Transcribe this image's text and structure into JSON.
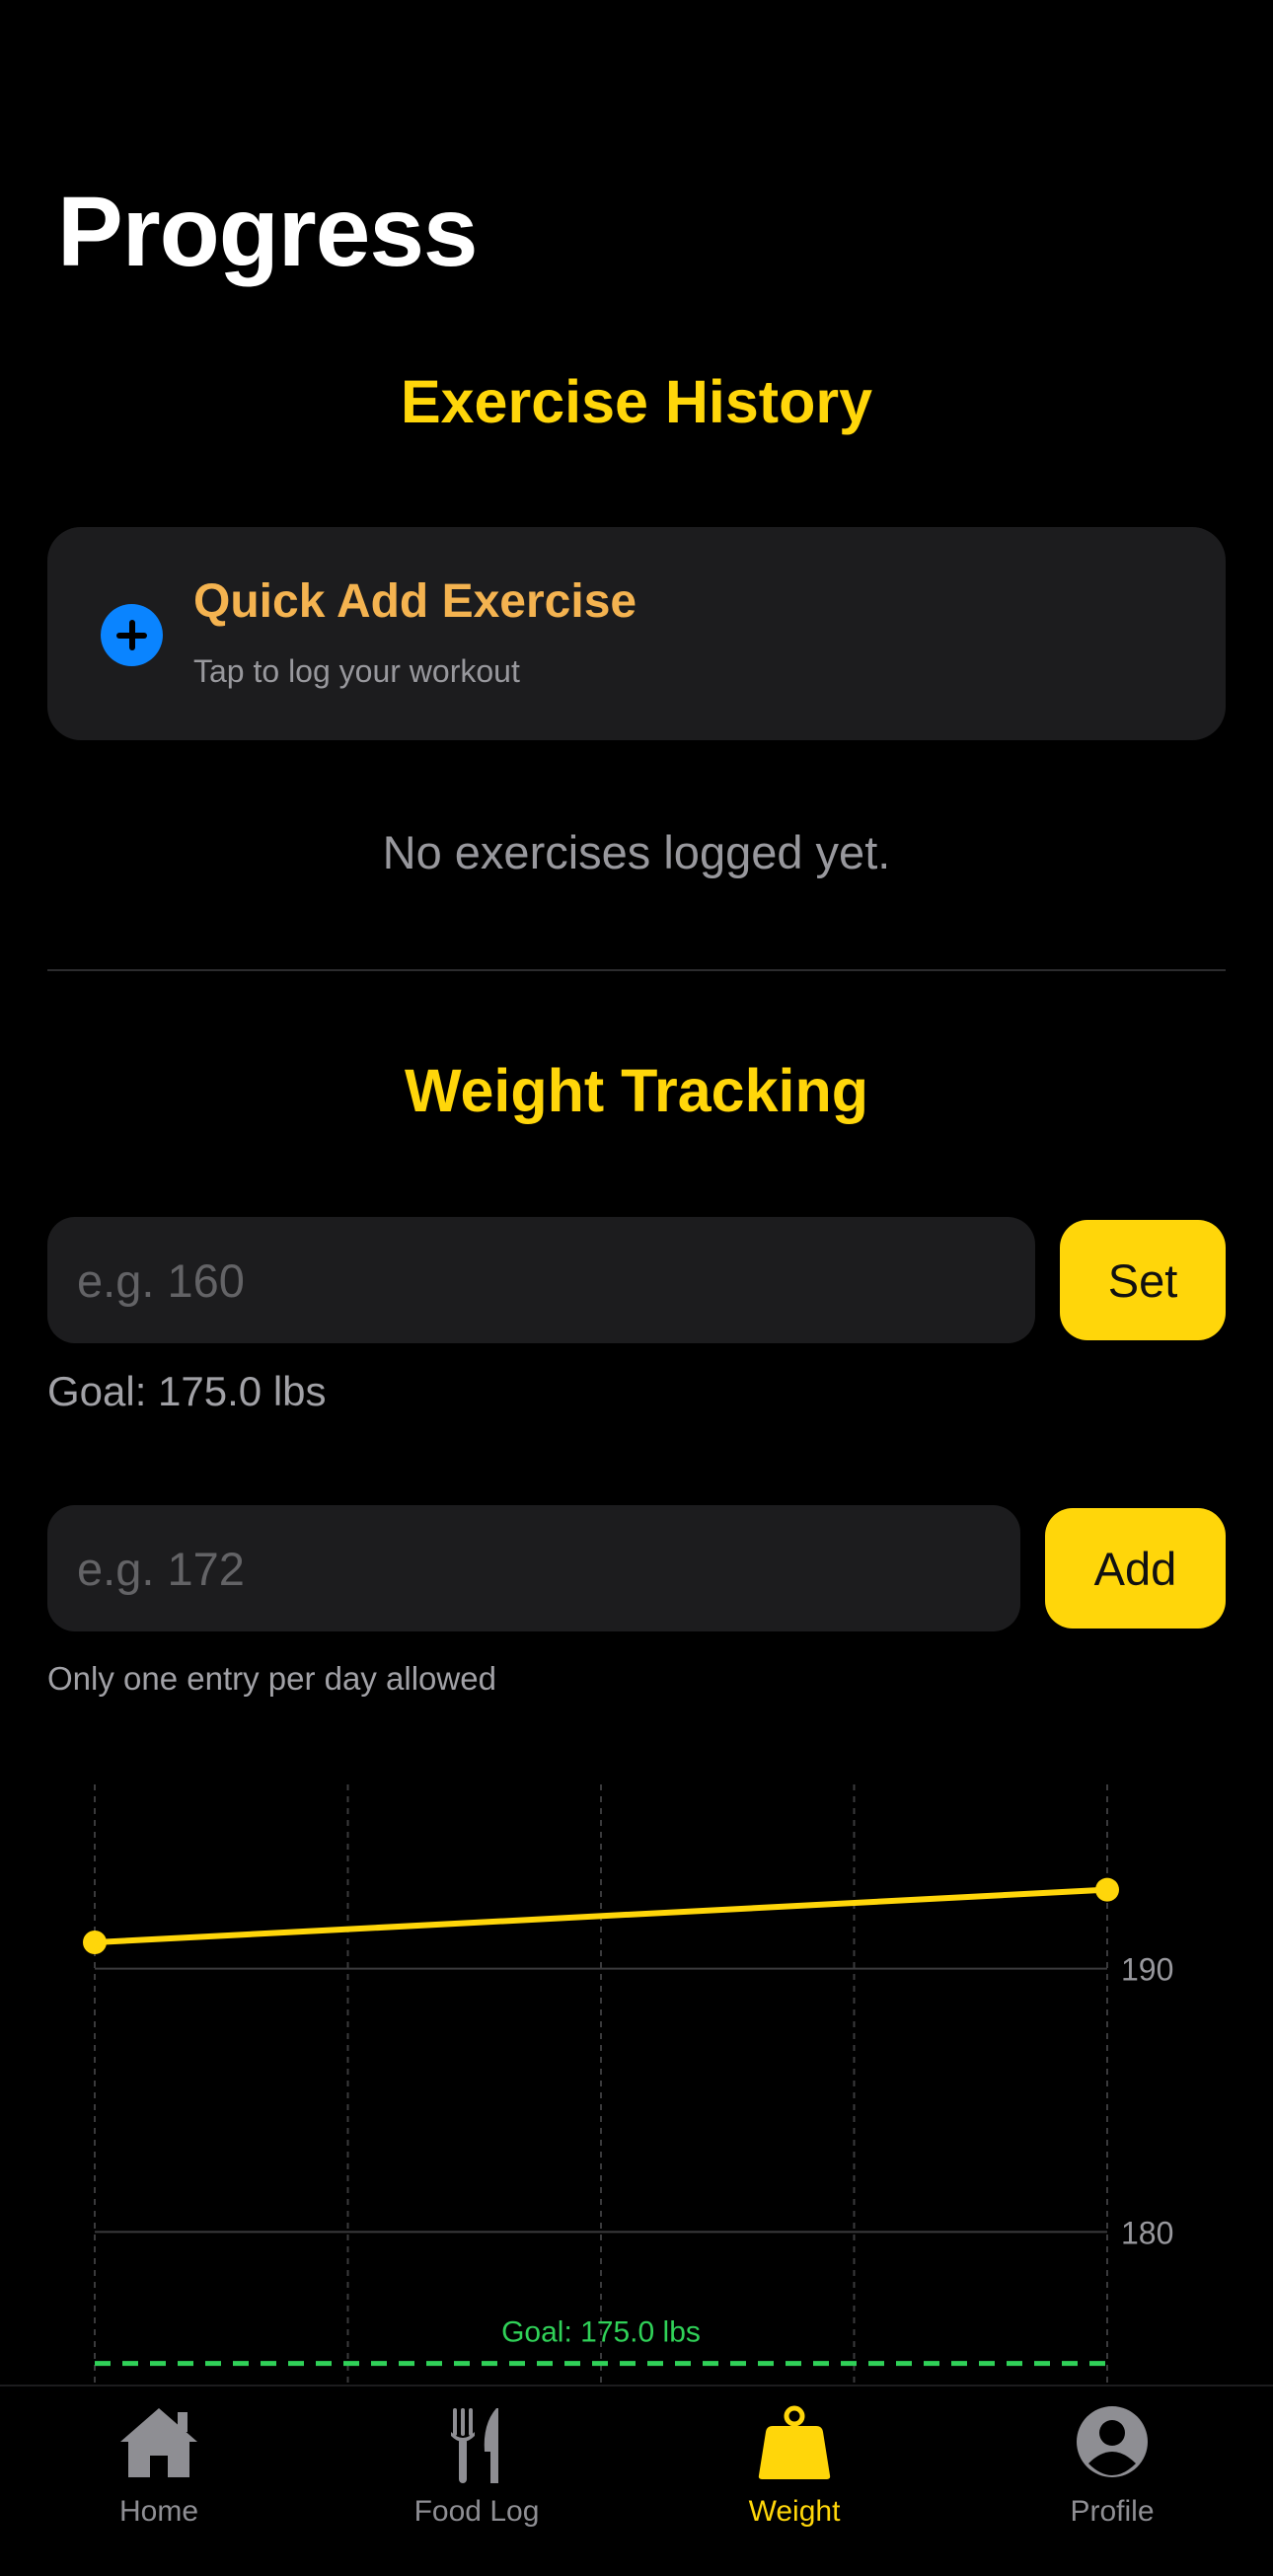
{
  "page": {
    "title": "Progress"
  },
  "exercise": {
    "section_title": "Exercise History",
    "quick_add": {
      "title": "Quick Add Exercise",
      "subtitle": "Tap to log your workout"
    },
    "empty_text": "No exercises logged yet."
  },
  "weight": {
    "section_title": "Weight Tracking",
    "goal_input": {
      "placeholder": "e.g. 160",
      "button_label": "Set"
    },
    "goal_text": "Goal: 175.0 lbs",
    "entry_input": {
      "placeholder": "e.g. 172",
      "button_label": "Add"
    },
    "hint_text": "Only one entry per day allowed"
  },
  "chart_data": {
    "type": "line",
    "series": [
      {
        "values": [
          191,
          193
        ]
      }
    ],
    "ytick_labels": [
      "190",
      "180"
    ],
    "yticks": [
      190,
      180
    ],
    "ylim": [
      174.2,
      197
    ],
    "goal": {
      "value": 175,
      "label": "Goal: 175.0 lbs"
    },
    "colors": {
      "line": "#ffd60a",
      "goal": "#30d158",
      "grid": "#3a3a3c"
    },
    "grid": true
  },
  "tabbar": {
    "items": [
      {
        "label": "Home",
        "icon": "house-icon"
      },
      {
        "label": "Food Log",
        "icon": "fork-knife-icon"
      },
      {
        "label": "Weight",
        "icon": "weight-icon",
        "active": true
      },
      {
        "label": "Profile",
        "icon": "person-circle-icon"
      }
    ]
  },
  "colors": {
    "accent": "#ffd60a",
    "card": "#1c1c1e",
    "link": "#0a84ff",
    "quick_title": "#f4b350"
  }
}
